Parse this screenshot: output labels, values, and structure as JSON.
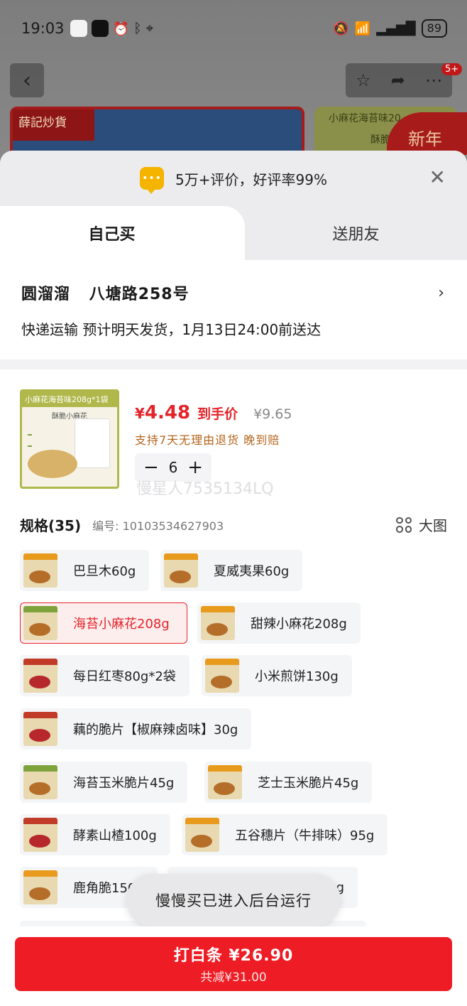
{
  "status_bar": {
    "time": "19:03",
    "battery": "89"
  },
  "nav": {
    "badge": "5+"
  },
  "banners": {
    "brand_logo": "薛記炒貨",
    "product_title": "小麻花海苔味20",
    "product_sub": "酥脆小",
    "promo": "新年"
  },
  "sheet": {
    "review_summary": "5万+评价，好评率99%",
    "tabs": [
      {
        "label": "自己买"
      },
      {
        "label": "送朋友"
      }
    ]
  },
  "address": {
    "name": "圆溜溜",
    "street": "八塘路258号",
    "delivery": "快递运输 预计明天发货，1月13日24:00前送达"
  },
  "product": {
    "image_band": "小麻花海苔味208g*1袋",
    "image_sub": "酥脆小麻花",
    "price_symbol": "¥",
    "price": "4.48",
    "price_label": "到手价",
    "original_price": "¥9.65",
    "promise": "支持7天无理由退货 晚到赔",
    "quantity": "6",
    "watermark": "慢星人7535134LQ"
  },
  "spec": {
    "title": "规格(35)",
    "code": "编号: 10103534627903",
    "big_picture": "大图",
    "items": [
      {
        "label": "巴旦木60g"
      },
      {
        "label": "夏威夷果60g"
      },
      {
        "label": "海苔小麻花208g",
        "selected": true
      },
      {
        "label": "甜辣小麻花208g"
      },
      {
        "label": "每日红枣80g*2袋"
      },
      {
        "label": "小米煎饼130g"
      },
      {
        "label": "藕的脆片【椒麻辣卤味】30g"
      },
      {
        "label": "海苔玉米脆片45g"
      },
      {
        "label": "芝士玉米脆片45g"
      },
      {
        "label": "酵素山楂100g"
      },
      {
        "label": "五谷穗片（牛排味）95g"
      },
      {
        "label": "鹿角脆150"
      },
      {
        "label": "g"
      }
    ]
  },
  "toast": "慢慢买已进入后台运行",
  "footer": {
    "pay_label": "打白条 ¥26.90",
    "discount": "共减¥31.00"
  },
  "colors": {
    "accent": "#ee1c25",
    "price": "#e3242b",
    "promise": "#b5651d"
  }
}
